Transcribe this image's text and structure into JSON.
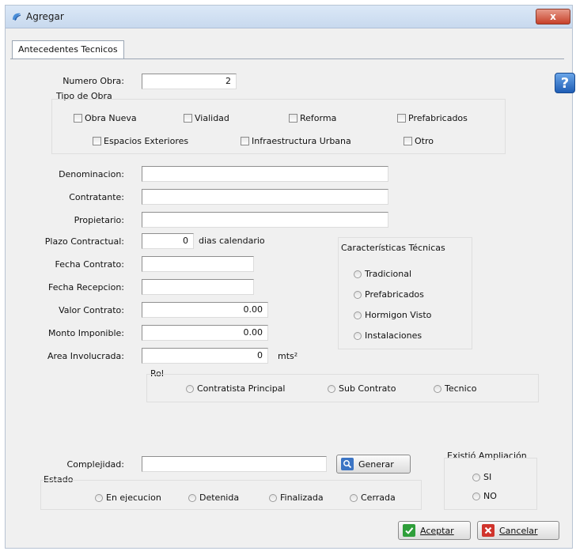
{
  "window": {
    "title": "Agregar",
    "close_glyph": "x"
  },
  "tab": {
    "label": "Antecedentes Tecnicos"
  },
  "help_glyph": "?",
  "numero_obra": {
    "label": "Numero Obra:",
    "value": "2"
  },
  "tipo_obra": {
    "legend": "Tipo de Obra",
    "options": [
      "Obra Nueva",
      "Vialidad",
      "Reforma",
      "Prefabricados",
      "Espacios Exteriores",
      "Infraestructura Urbana",
      "Otro"
    ]
  },
  "fields": {
    "denominacion": {
      "label": "Denominacion:",
      "value": ""
    },
    "contratante": {
      "label": "Contratante:",
      "value": ""
    },
    "propietario": {
      "label": "Propietario:",
      "value": ""
    },
    "plazo": {
      "label": "Plazo Contractual:",
      "value": "0",
      "suffix": "dias calendario"
    },
    "fecha_contrato": {
      "label": "Fecha Contrato:",
      "value": ""
    },
    "fecha_recepcion": {
      "label": "Fecha Recepcion:",
      "value": ""
    },
    "valor_contrato": {
      "label": "Valor Contrato:",
      "value": "0.00"
    },
    "monto_imponible": {
      "label": "Monto Imponible:",
      "value": "0.00"
    },
    "area_involucrada": {
      "label": "Area Involucrada:",
      "value": "0",
      "suffix": "mts²"
    }
  },
  "caracteristicas": {
    "legend": "Características Técnicas",
    "options": [
      "Tradicional",
      "Prefabricados",
      "Hormigon Visto",
      "Instalaciones"
    ]
  },
  "rol": {
    "legend": "Rol",
    "options": [
      "Contratista Principal",
      "Sub Contrato",
      "Tecnico"
    ]
  },
  "complejidad": {
    "label": "Complejidad:",
    "value": "",
    "button": "Generar"
  },
  "estado": {
    "legend": "Estado",
    "options": [
      "En ejecucion",
      "Detenida",
      "Finalizada",
      "Cerrada"
    ]
  },
  "ampliacion": {
    "legend": "Existió Ampliación",
    "options": [
      "SI",
      "NO"
    ]
  },
  "footer": {
    "accept_label": "Aceptar",
    "cancel_label": "Cancelar"
  },
  "colors": {
    "accent": "#1f5db5",
    "accept_icon": "#2e9e3a",
    "cancel_icon": "#d0342c"
  }
}
